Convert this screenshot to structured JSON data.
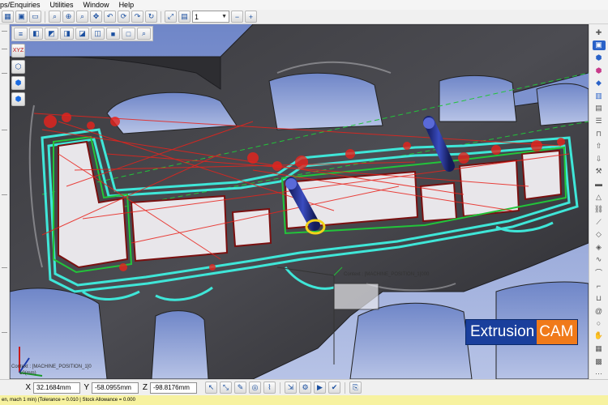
{
  "menu": {
    "items": [
      "ps/Enquiries",
      "Utilities",
      "Window",
      "Help"
    ]
  },
  "toolbar": {
    "layer_select_value": "1"
  },
  "viewport": {
    "context_label_main": "Context : [MACHINE_POSITION_1]000",
    "context_label_corner_line1": "Context : [MACHINE_POSITION_1]0",
    "context_label_corner_line2": "10(mm)",
    "axis_labels": {
      "x": "X",
      "y": "Y",
      "z": "Z"
    }
  },
  "logo": {
    "part1": "Extrusion",
    "part2": "CAM",
    "color_part1": "#1a3f9c",
    "color_part2": "#f07a1a"
  },
  "coordinates": {
    "x_label": "X",
    "x_value": "32.1684mm",
    "y_label": "Y",
    "y_value": "-58.0955mm",
    "z_label": "Z",
    "z_value": "-98.8176mm"
  },
  "status": {
    "text": "en, mach 1 min) (Tolerance = 0.010 | Stock Allowance = 0.000"
  },
  "colors": {
    "toolpath_cyan": "#3fe6d8",
    "toolpath_red": "#e8231c",
    "toolpath_green": "#22c43a",
    "tool_blue": "#2a3a9a",
    "background_blue": "#8fa4d8"
  }
}
